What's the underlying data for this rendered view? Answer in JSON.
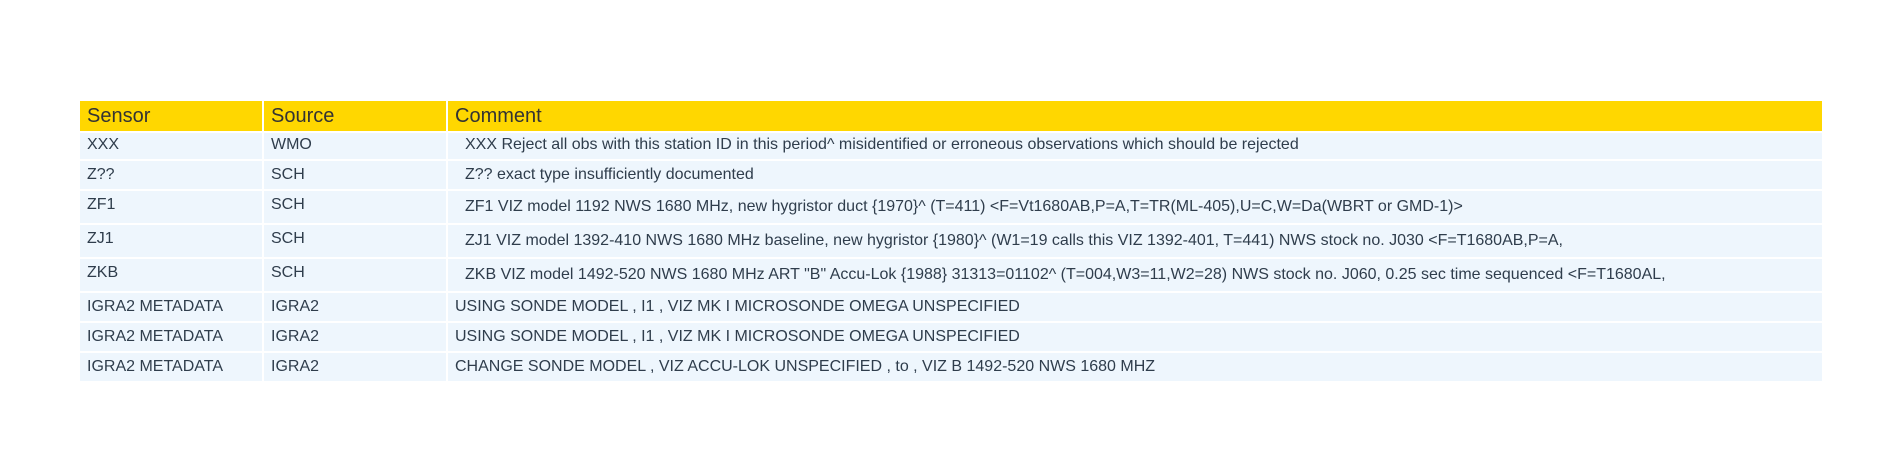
{
  "table": {
    "headers": {
      "sensor": "Sensor",
      "source": "Source",
      "comment": "Comment"
    },
    "rows": [
      {
        "sensor": "XXX",
        "source": "WMO",
        "comment": "XXX Reject all obs with this station ID in this period^ misidentified or erroneous observations which should be rejected"
      },
      {
        "sensor": "Z??",
        "source": "SCH",
        "comment": "Z?? exact type insufficiently documented"
      },
      {
        "sensor": "ZF1",
        "source": "SCH",
        "comment": "ZF1 VIZ model 1192 NWS 1680 MHz, new hygristor duct {1970}^ (T=411) <F=Vt1680AB,P=A,T=TR(ML-405),U=C,W=Da(WBRT or GMD-1)>"
      },
      {
        "sensor": "ZJ1",
        "source": "SCH",
        "comment": "ZJ1 VIZ model 1392-410 NWS 1680 MHz baseline, new hygristor {1980}^ (W1=19 calls this VIZ 1392-401, T=441) NWS stock no. J030 <F=T1680AB,P=A,"
      },
      {
        "sensor": "ZKB",
        "source": "SCH",
        "comment": "ZKB VIZ model 1492-520 NWS 1680 MHz ART \"B\" Accu-Lok {1988} 31313=01102^ (T=004,W3=11,W2=28) NWS stock no. J060, 0.25 sec time sequenced <F=T1680AL,"
      },
      {
        "sensor": "IGRA2 METADATA",
        "source": "IGRA2",
        "comment": "USING SONDE MODEL , I1 , VIZ MK I MICROSONDE OMEGA UNSPECIFIED"
      },
      {
        "sensor": "IGRA2 METADATA",
        "source": "IGRA2",
        "comment": "USING SONDE MODEL , I1 , VIZ MK I MICROSONDE OMEGA UNSPECIFIED"
      },
      {
        "sensor": "IGRA2 METADATA",
        "source": "IGRA2",
        "comment": "CHANGE SONDE MODEL , VIZ ACCU-LOK UNSPECIFIED , to , VIZ B 1492-520 NWS 1680 MHZ"
      }
    ]
  },
  "colors": {
    "header_bg": "#FFD700",
    "row_bg": "#EEF6FD",
    "text": "#2F3D4C"
  }
}
